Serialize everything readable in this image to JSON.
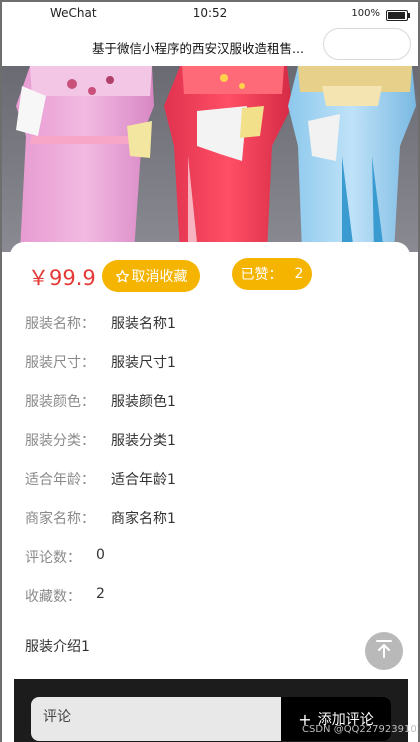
{
  "status_bar": {
    "carrier": "WeChat",
    "time": "10:52",
    "battery": "100%"
  },
  "nav": {
    "title": "基于微信小程序的西安汉服收造租售..."
  },
  "detail": {
    "price": "￥99.9",
    "favorite_button": "取消收藏",
    "likes_label": "已赞：",
    "likes_count": "2",
    "fields": [
      {
        "label": "服装名称：",
        "value": "服装名称1"
      },
      {
        "label": "服装尺寸：",
        "value": "服装尺寸1"
      },
      {
        "label": "服装颜色：",
        "value": "服装颜色1"
      },
      {
        "label": "服装分类：",
        "value": "服装分类1"
      },
      {
        "label": "适合年龄：",
        "value": "适合年龄1"
      },
      {
        "label": "商家名称：",
        "value": "商家名称1"
      },
      {
        "label": "评论数：",
        "value": "0"
      },
      {
        "label": "收藏数：",
        "value": "2"
      }
    ],
    "intro": "服装介绍1"
  },
  "comment": {
    "placeholder": "评论",
    "add_button": "添加评论"
  },
  "watermark": "CSDN @QQ2279239102",
  "colors": {
    "accent": "#f5b400",
    "price": "#e53935"
  }
}
